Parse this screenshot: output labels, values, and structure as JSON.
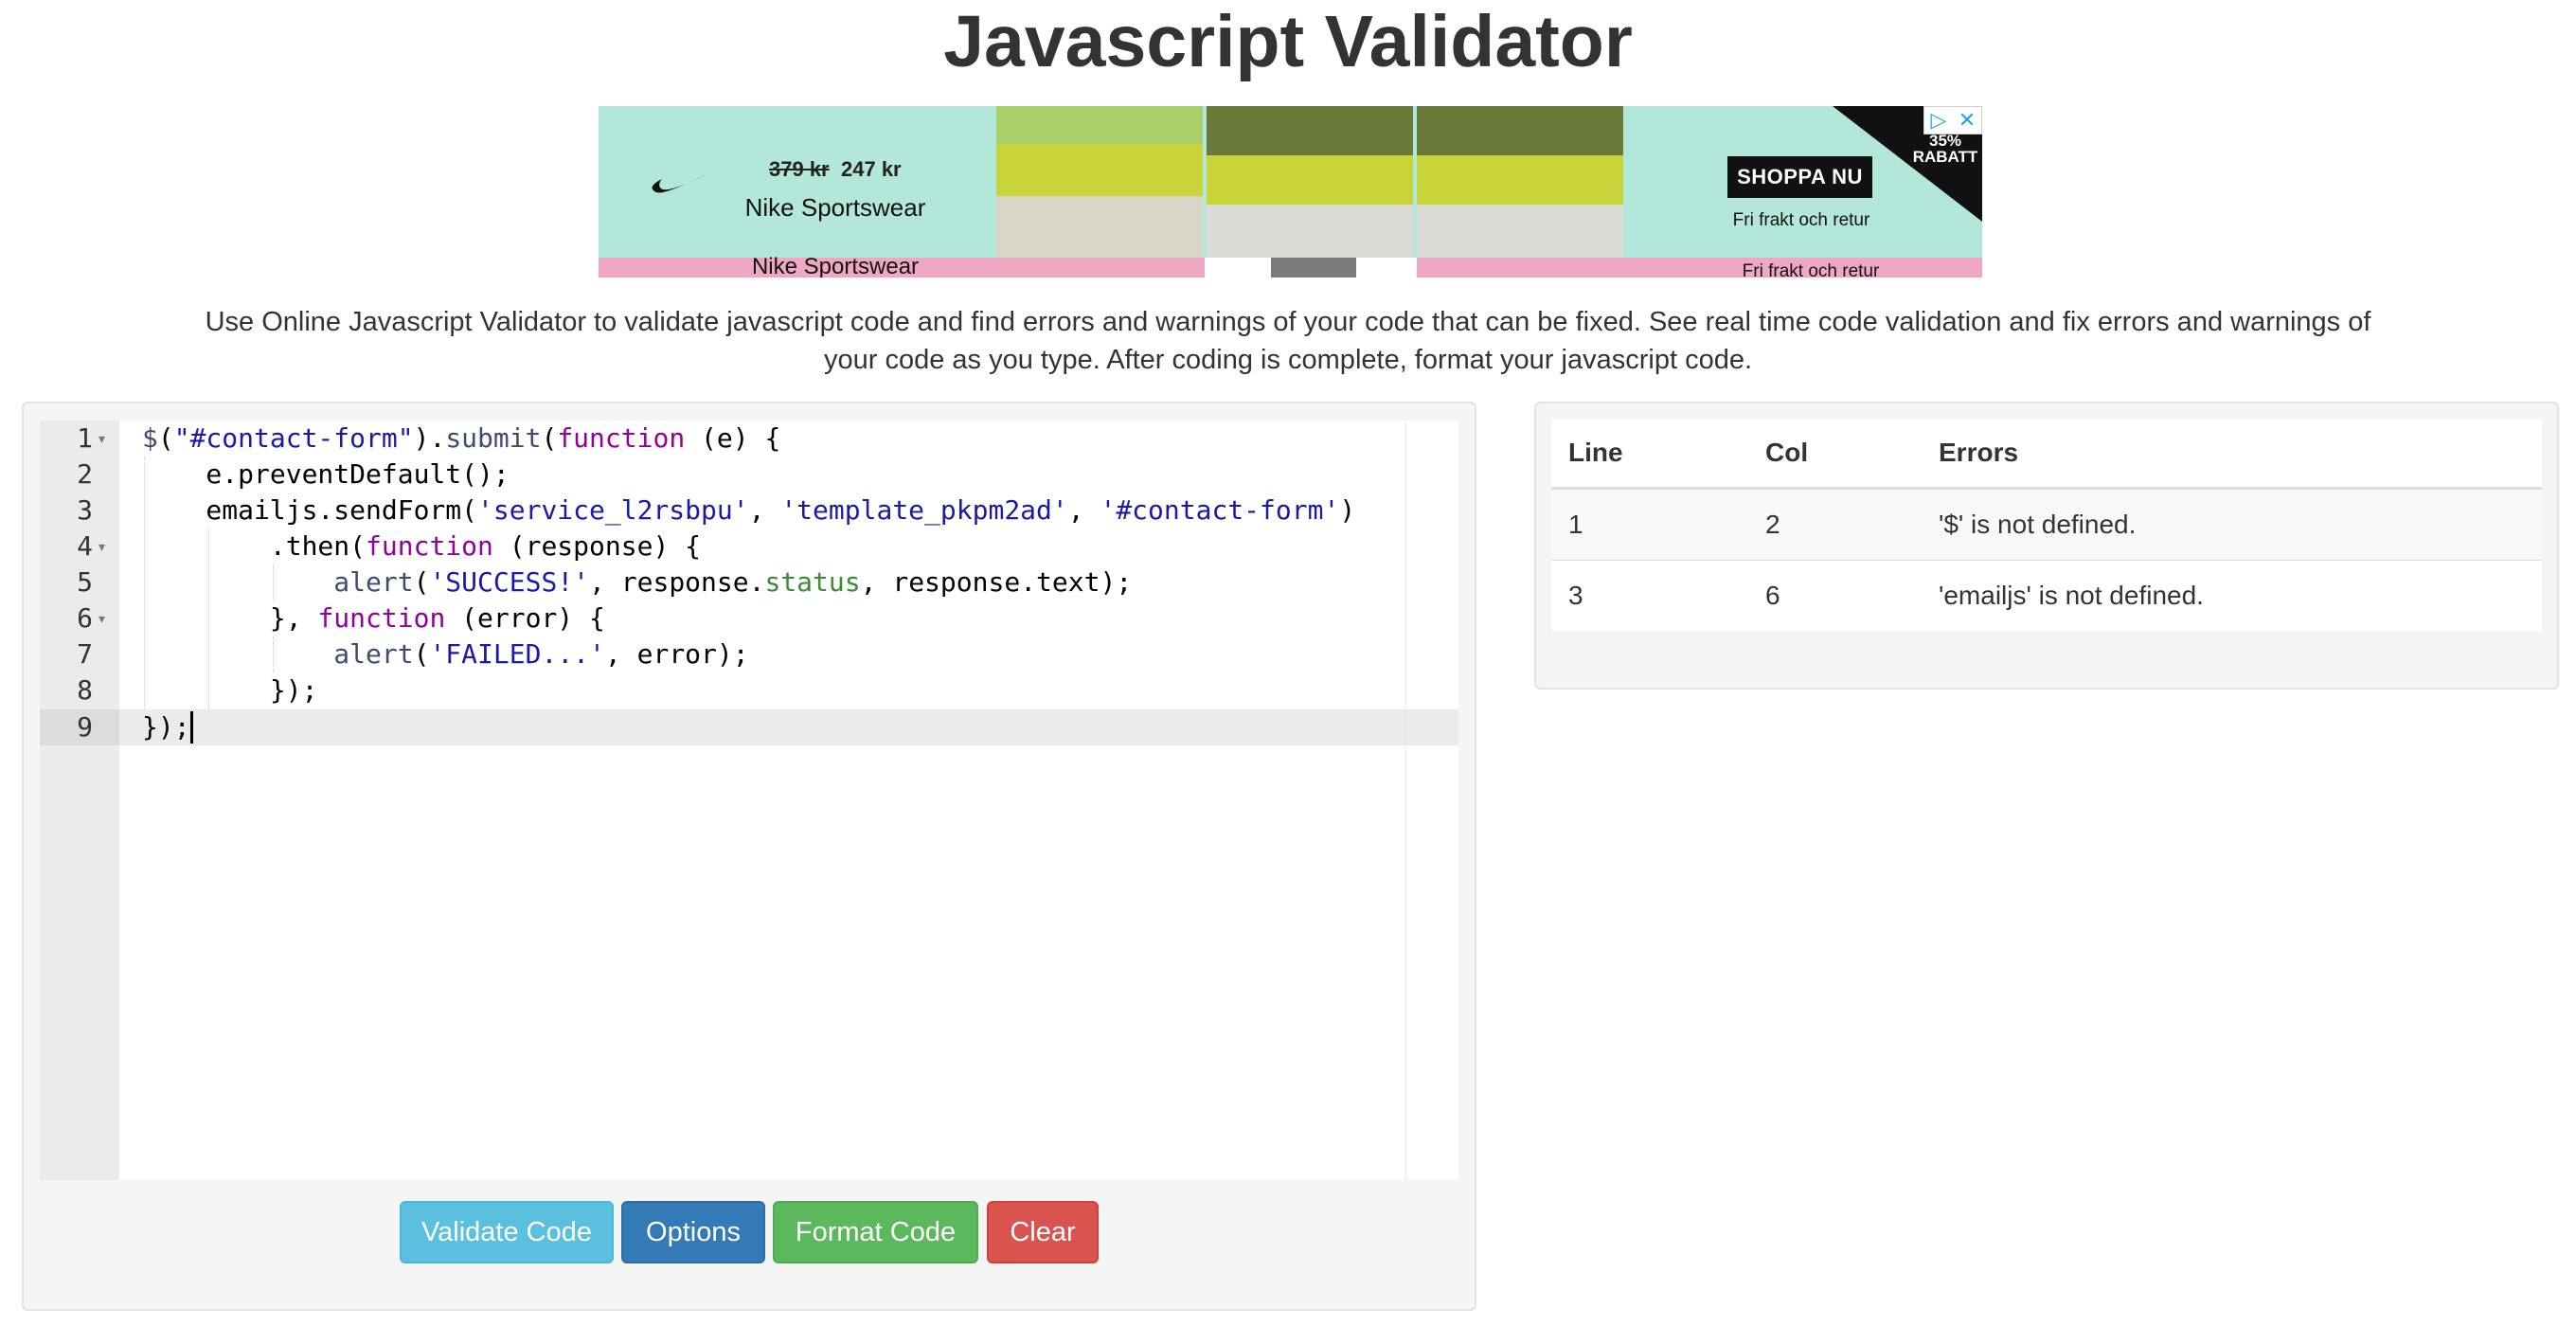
{
  "page": {
    "title": "Javascript Validator",
    "description": "Use Online Javascript Validator to validate javascript code and find errors and warnings of your code that can be fixed. See real time code validation and fix errors and warnings of your code as you type. After coding is complete, format your javascript code."
  },
  "ad": {
    "price_old": "379 kr",
    "price_new": "247 kr",
    "brand": "Nike Sportswear",
    "cta": "SHOPPA NU",
    "shipping": "Fri frakt och retur",
    "discount": "35% RABATT",
    "brand_strip": "Nike Sportswear",
    "shipping_strip": "Fri frakt och retur",
    "colors": {
      "background": "#b2e7da",
      "strip": "#efa7c4"
    }
  },
  "editor": {
    "line_numbers": [
      "1",
      "2",
      "3",
      "4",
      "5",
      "6",
      "7",
      "8",
      "9"
    ],
    "active_line": 9
  },
  "buttons": {
    "validate": "Validate Code",
    "options": "Options",
    "format": "Format Code",
    "clear": "Clear"
  },
  "errors": {
    "headers": {
      "line": "Line",
      "col": "Col",
      "errors": "Errors"
    },
    "rows": [
      {
        "line": "1",
        "col": "2",
        "message": "'$' is not defined."
      },
      {
        "line": "3",
        "col": "6",
        "message": "'emailjs' is not defined."
      }
    ]
  },
  "colors": {
    "info": "#5bc0de",
    "primary": "#337ab7",
    "success": "#5cb85c",
    "danger": "#d9534f"
  }
}
